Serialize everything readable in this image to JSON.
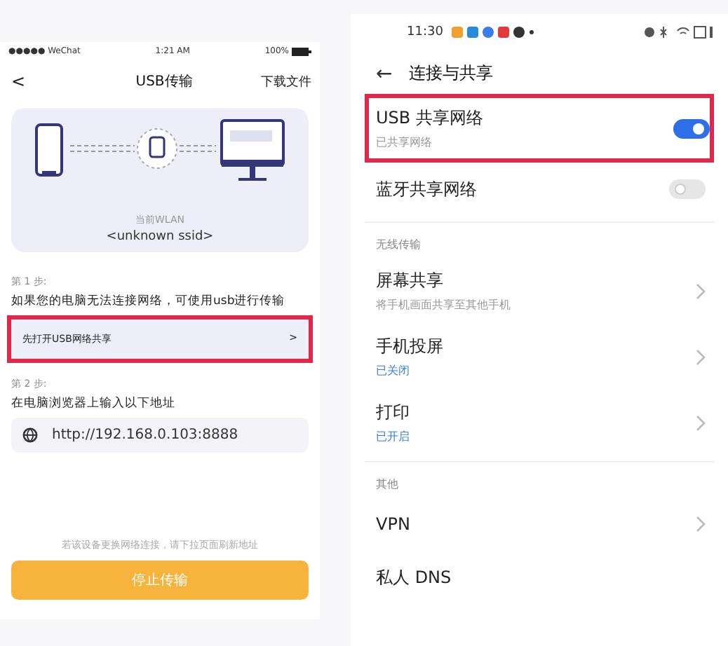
{
  "left_phone": {
    "status_bar": {
      "carrier": "●●●●● WeChat",
      "time": "1:21 AM",
      "battery": "100%"
    },
    "nav": {
      "back": "<",
      "title": "USB传输",
      "action": "下载文件"
    },
    "card": {
      "label": "当前WLAN",
      "ssid": "<unknown ssid>"
    },
    "steps": [
      {
        "label": "第 1 步:",
        "text": "如果您的电脑无法连接网络，可使用usb进行传输",
        "kind": "button",
        "value": "先打开USB网络共享",
        "chevron": ">",
        "highlighted": true
      },
      {
        "label": "第 2 步:",
        "text": "在电脑浏览器上输入以下地址",
        "kind": "address",
        "value": "http://192.168.0.103:8888",
        "highlighted": false
      }
    ],
    "hint": "若该设备更换网络连接，请下拉页面刷新地址",
    "stop_button": "停止传输"
  },
  "right_phone": {
    "status_bar": {
      "time": "11:30"
    },
    "nav": {
      "back": "←",
      "title": "连接与共享"
    },
    "sections": [
      {
        "items": [
          {
            "title": "USB 共享网络",
            "subtitle": "已共享网络",
            "kind": "toggle",
            "on": true,
            "highlighted": true
          },
          {
            "title": "蓝牙共享网络",
            "kind": "toggle",
            "on": false,
            "highlighted": false
          }
        ]
      },
      {
        "header": "无线传输",
        "items": [
          {
            "title": "屏幕共享",
            "subtitle": "将手机画面共享至其他手机",
            "kind": "link",
            "status": false,
            "highlighted": false
          },
          {
            "title": "手机投屏",
            "subtitle": "已关闭",
            "kind": "link",
            "status": true,
            "highlighted": false
          },
          {
            "title": "打印",
            "subtitle": "已开启",
            "kind": "link",
            "status": true,
            "highlighted": false
          }
        ]
      },
      {
        "header": "其他",
        "items": [
          {
            "title": "VPN",
            "kind": "link",
            "highlighted": false
          },
          {
            "title": "私人 DNS",
            "kind": "plain",
            "highlighted": false
          }
        ]
      }
    ]
  }
}
